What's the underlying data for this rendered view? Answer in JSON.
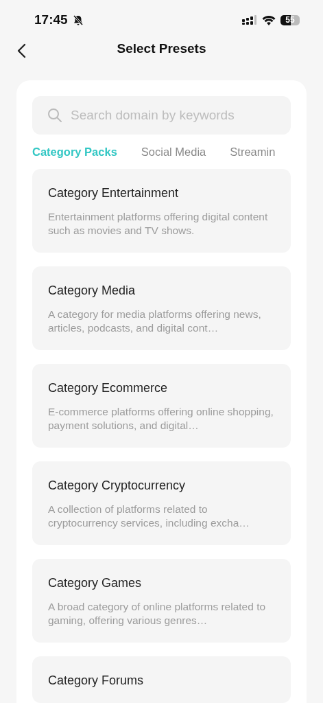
{
  "status_bar": {
    "time": "17:45",
    "battery": "55"
  },
  "header": {
    "title": "Select Presets"
  },
  "search": {
    "placeholder": "Search domain by keywords"
  },
  "tabs": [
    {
      "label": "Category Packs",
      "selected": true
    },
    {
      "label": "Social Media",
      "selected": false
    },
    {
      "label": "Streamin",
      "selected": false
    }
  ],
  "presets": [
    {
      "title": "Category Entertainment",
      "description": "Entertainment platforms offering digital content such as movies and TV shows."
    },
    {
      "title": "Category Media",
      "description": "A category for media platforms offering news, articles, podcasts, and digital cont…"
    },
    {
      "title": "Category Ecommerce",
      "description": "E-commerce platforms offering online shopping, payment solutions, and digital…"
    },
    {
      "title": "Category Cryptocurrency",
      "description": "A collection of platforms related to cryptocurrency services, including excha…"
    },
    {
      "title": "Category Games",
      "description": "A broad category of online platforms related to gaming, offering various genres…"
    },
    {
      "title": "Category Forums"
    }
  ]
}
